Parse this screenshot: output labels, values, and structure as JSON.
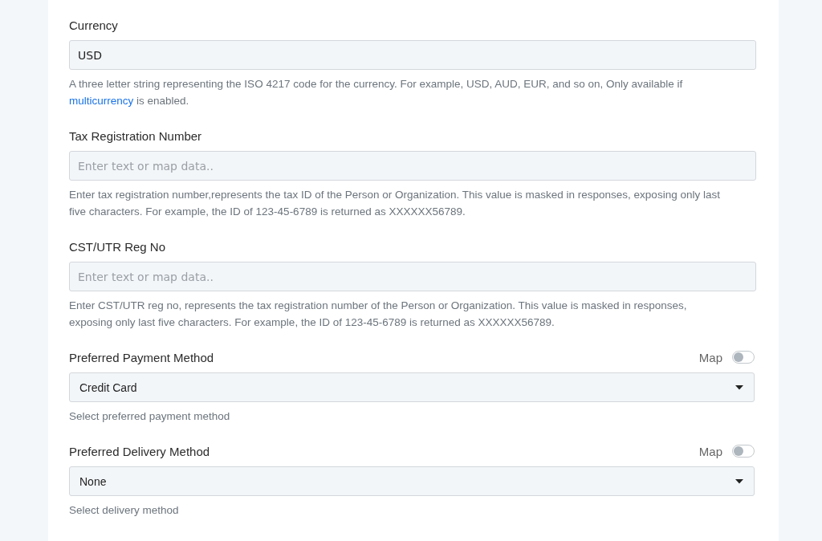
{
  "fields": [
    {
      "kind": "text",
      "label": "Currency",
      "value": "USD",
      "help": [
        {
          "kind": "text",
          "text": "A three letter string representing the ISO 4217 code for the currency. For example, USD, AUD, EUR, and so on, Only available if"
        },
        {
          "kind": "link",
          "text": "multicurrency"
        },
        {
          "kind": "text",
          "text": "is enabled."
        }
      ]
    },
    {
      "kind": "text",
      "label": "Tax Registration Number",
      "placeholder": "Enter text or map data..",
      "help": [
        {
          "kind": "text",
          "text": "Enter tax registration number,represents the tax ID of the Person or Organization. This value is masked in responses, exposing only last five characters. For example, the ID of 123-45-6789 is returned as XXXXXX56789."
        }
      ]
    },
    {
      "kind": "text",
      "label": "CST/UTR Reg No",
      "placeholder": "Enter text or map data..",
      "help": [
        {
          "kind": "text",
          "text": "Enter CST/UTR reg no, represents the tax registration number of the Person or Organization. This value is masked in responses, exposing only last five characters. For example, the ID of 123-45-6789 is returned as XXXXXX56789."
        }
      ]
    },
    {
      "kind": "select",
      "label": "Preferred Payment Method",
      "map_label": "Map",
      "map_on": false,
      "value": "Credit Card",
      "help": [
        {
          "kind": "text",
          "text": "Select preferred payment method"
        }
      ]
    },
    {
      "kind": "select",
      "label": "Preferred Delivery Method",
      "map_label": "Map",
      "map_on": false,
      "value": "None",
      "help": [
        {
          "kind": "text",
          "text": "Select delivery method"
        }
      ]
    }
  ]
}
